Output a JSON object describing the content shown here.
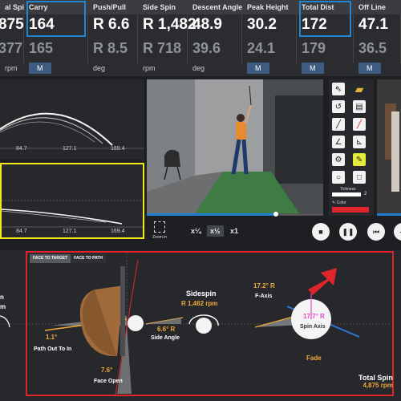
{
  "stats": [
    {
      "header": "al Spin",
      "value": "875",
      "avg": "377",
      "unit": "rpm"
    },
    {
      "header": "Carry",
      "value": "164",
      "avg": "165",
      "unit": "M"
    },
    {
      "header": "Push/Pull",
      "value": "R 6.6",
      "avg": "R 8.5",
      "unit": "deg"
    },
    {
      "header": "Side Spin",
      "value": "R 1,482",
      "avg": "R 718",
      "unit": "rpm"
    },
    {
      "header": "Descent Angle",
      "value": "48.9",
      "avg": "39.6",
      "unit": "deg"
    },
    {
      "header": "Peak Height",
      "value": "30.2",
      "avg": "24.1",
      "unit": "M"
    },
    {
      "header": "Total Dist",
      "value": "172",
      "avg": "179",
      "unit": "M"
    },
    {
      "header": "Off Line",
      "value": "47.1",
      "avg": "36.5",
      "unit": "M"
    }
  ],
  "trajectory_top": {
    "ticks": [
      "84.7",
      "127.1",
      "169.4"
    ]
  },
  "trajectory_bottom": {
    "ticks": [
      "84.7",
      "127.1",
      "169.4"
    ]
  },
  "palette": {
    "thickness_label": "Tickness",
    "thickness_value": "2",
    "color_label": "Color",
    "selected_color": "#e0242b"
  },
  "controls": {
    "zoom_label": "Zoom in",
    "speeds": [
      "x¼",
      "x½",
      "x1"
    ],
    "active_speed": "x½"
  },
  "analysis": {
    "tabs": [
      "FACE TO TARGET",
      "FACE TO PATH"
    ],
    "active_tab": "FACE TO TARGET",
    "path_value": "1.1°",
    "path_label": "Path Out To In",
    "face_value": "7.6°",
    "face_label": "Face Open",
    "sidespin_title": "Sidespin",
    "sidespin_value": "R 1,482 rpm",
    "side_angle_value": "6.6° R",
    "side_angle_label": "Side Angle",
    "faxis_value": "17.2° R",
    "faxis_label": "F-Axis",
    "spin_axis_value": "17.7° R",
    "spin_axis_label": "Spin Axis",
    "shape_label": "Fade",
    "total_spin_label": "Total Spin",
    "total_spin_value": "4,875 rpm"
  },
  "left_edge": {
    "partial_label": "m",
    "partial_label_top": "n"
  },
  "colors": {
    "highlight": "#1f86d6",
    "analysis_border": "#e0242b",
    "trajectory_box": "#f2ea1a",
    "accent": "#f2a93a"
  }
}
